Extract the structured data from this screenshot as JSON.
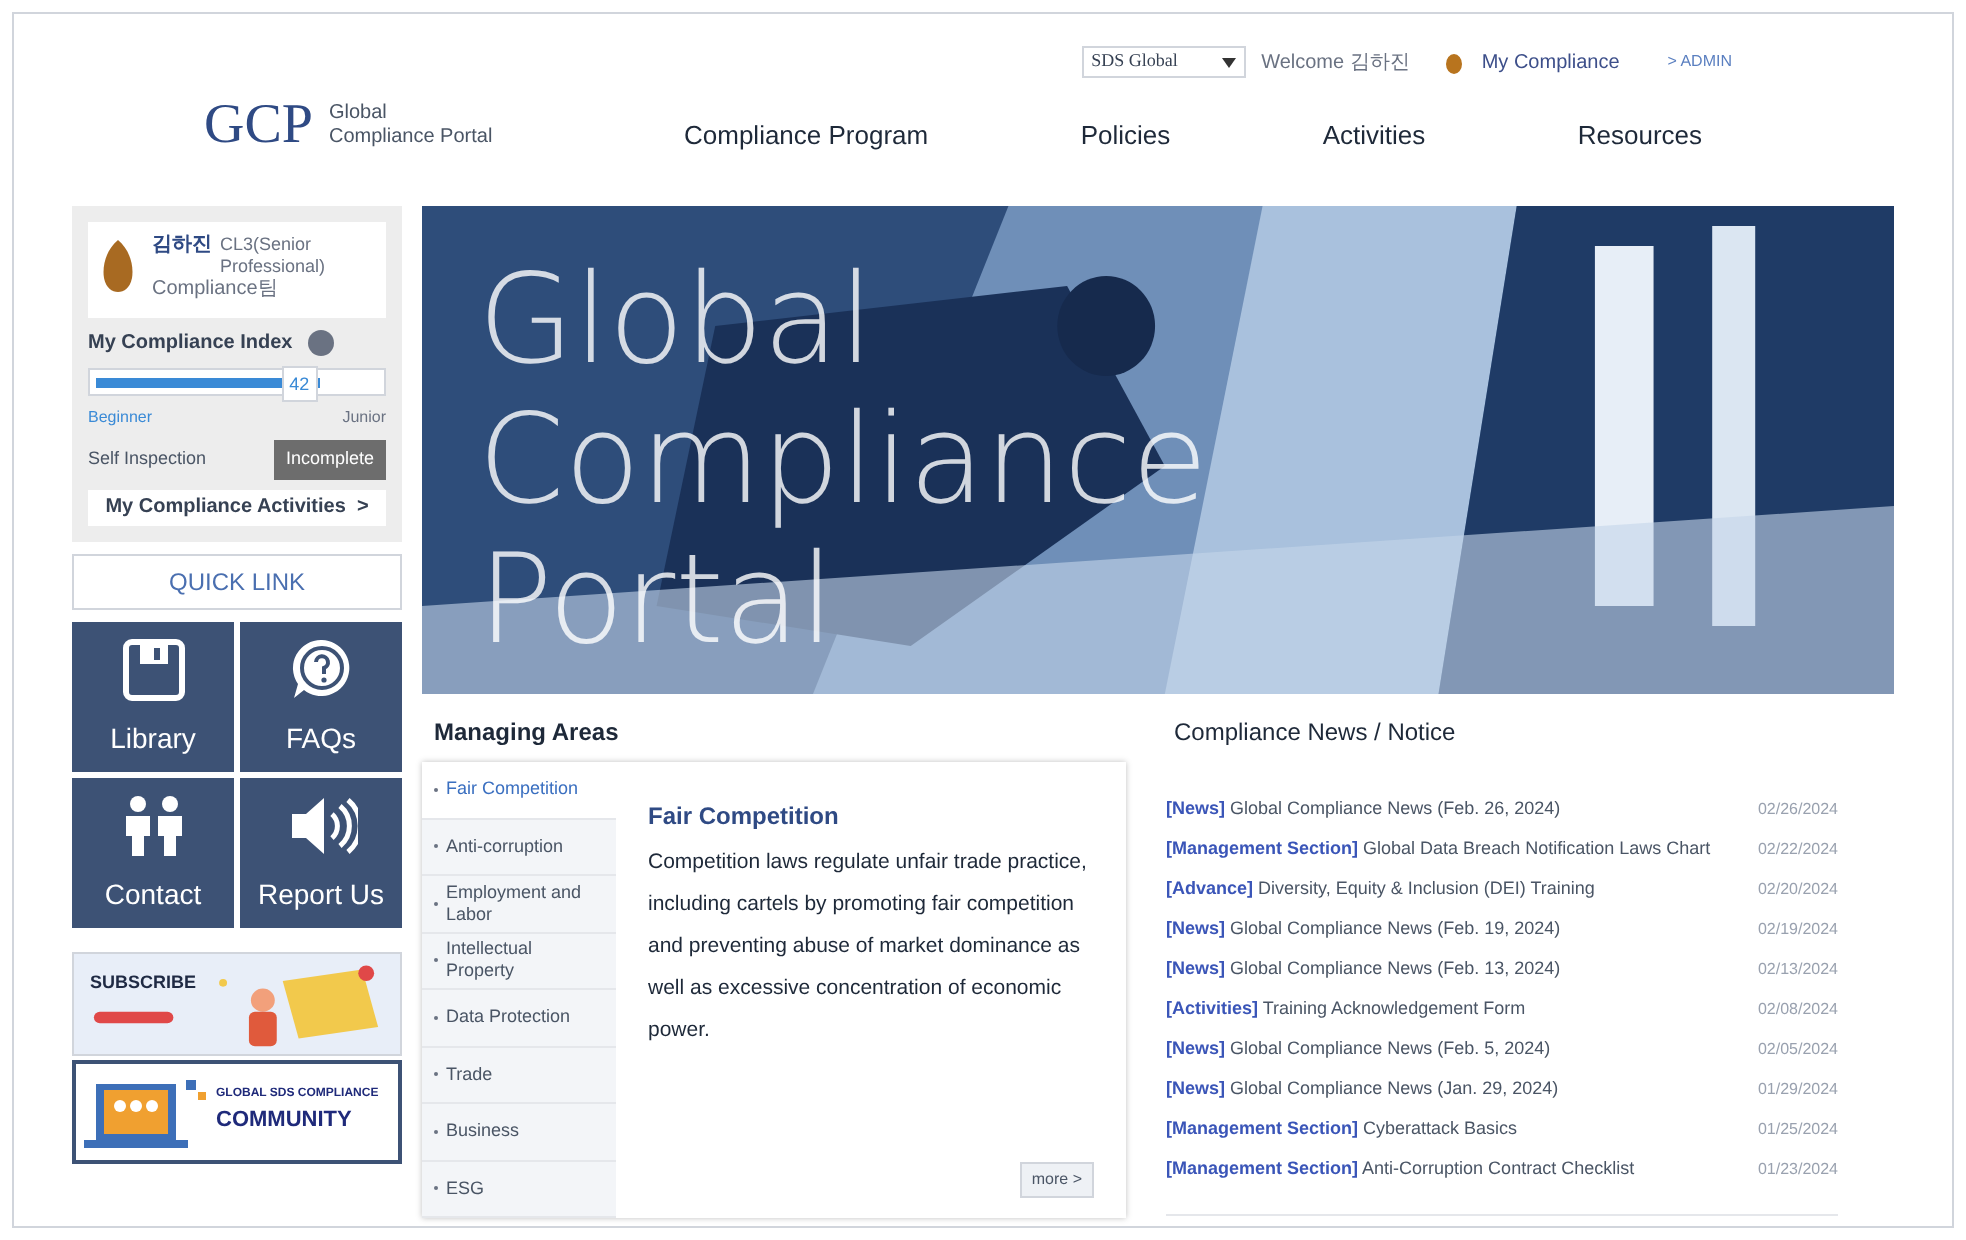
{
  "header": {
    "logo": "GCP",
    "logo_subtitle": [
      "Global",
      "Compliance Portal"
    ],
    "company_select": "SDS Global",
    "welcome": "Welcome 김하진",
    "my_compliance": "My Compliance",
    "admin": "> ADMIN",
    "nav": [
      {
        "label": "Compliance Program",
        "selected": false
      },
      {
        "label": "Policies",
        "selected": false
      },
      {
        "label": "Activities",
        "selected": false
      },
      {
        "label": "Resources",
        "selected": false
      }
    ]
  },
  "profile": {
    "name": "김하진",
    "title": "CL3(Senior Professional)",
    "team": "Compliance팀",
    "index_label": "My Compliance Index",
    "index_value": "42",
    "level": 0.8,
    "level_from": "Beginner",
    "level_to": "Junior",
    "inspection_label": "Self Inspection",
    "inspection_status": "Incomplete",
    "activities_button": "My Compliance Activities  >"
  },
  "quick_link": {
    "title": "QUICK LINK",
    "tiles": [
      {
        "kind": "library",
        "label": "Library"
      },
      {
        "kind": "faq",
        "label": "FAQs"
      },
      {
        "kind": "contact",
        "label": "Contact"
      },
      {
        "kind": "report",
        "label": "Report Us"
      }
    ]
  },
  "promos": [
    {
      "kind": "subscribe",
      "title": "SUBSCRIBE"
    },
    {
      "kind": "community",
      "subtitle": "GLOBAL SDS COMPLIANCE",
      "title": "COMMUNITY"
    }
  ],
  "banner": {
    "lines": [
      "Global",
      "Compliance",
      "Portal"
    ]
  },
  "managing_areas": {
    "title": "Managing Areas",
    "items": [
      {
        "label": "Fair Competition",
        "selected": true
      },
      {
        "label": "Anti-corruption",
        "selected": false
      },
      {
        "label": "Employment and Labor",
        "selected": false
      },
      {
        "label": "Intellectual Property",
        "selected": false
      },
      {
        "label": "Data Protection",
        "selected": false
      },
      {
        "label": "Trade",
        "selected": false
      },
      {
        "label": "Business",
        "selected": false
      },
      {
        "label": "ESG",
        "selected": false
      }
    ],
    "detail_title": "Fair Competition",
    "detail_text": "Competition laws regulate unfair trade practice, including cartels by promoting fair competition and preventing abuse of market dominance as well as excessive concentration of economic power.",
    "more": "more >"
  },
  "news": {
    "title": "Compliance News / Notice",
    "items": [
      {
        "tag": "[News]",
        "text": "Global Compliance News (Feb. 26, 2024)",
        "date": "02/26/2024"
      },
      {
        "tag": "[Management Section]",
        "text": "Global Data Breach Notification Laws Chart",
        "date": "02/22/2024"
      },
      {
        "tag": "[Advance]",
        "text": "Diversity, Equity & Inclusion (DEI) Training",
        "date": "02/20/2024"
      },
      {
        "tag": "[News]",
        "text": "Global Compliance News (Feb. 19, 2024)",
        "date": "02/19/2024"
      },
      {
        "tag": "[News]",
        "text": "Global Compliance News (Feb. 13, 2024)",
        "date": "02/13/2024"
      },
      {
        "tag": "[Activities]",
        "text": "Training Acknowledgement Form",
        "date": "02/08/2024"
      },
      {
        "tag": "[News]",
        "text": "Global Compliance News (Feb. 5, 2024)",
        "date": "02/05/2024"
      },
      {
        "tag": "[News]",
        "text": "Global Compliance News (Jan. 29, 2024)",
        "date": "01/29/2024"
      },
      {
        "tag": "[Management Section]",
        "text": "Cyberattack Basics",
        "date": "01/25/2024"
      },
      {
        "tag": "[Management Section]",
        "text": "Anti-Corruption Contract Checklist",
        "date": "01/23/2024"
      }
    ]
  }
}
